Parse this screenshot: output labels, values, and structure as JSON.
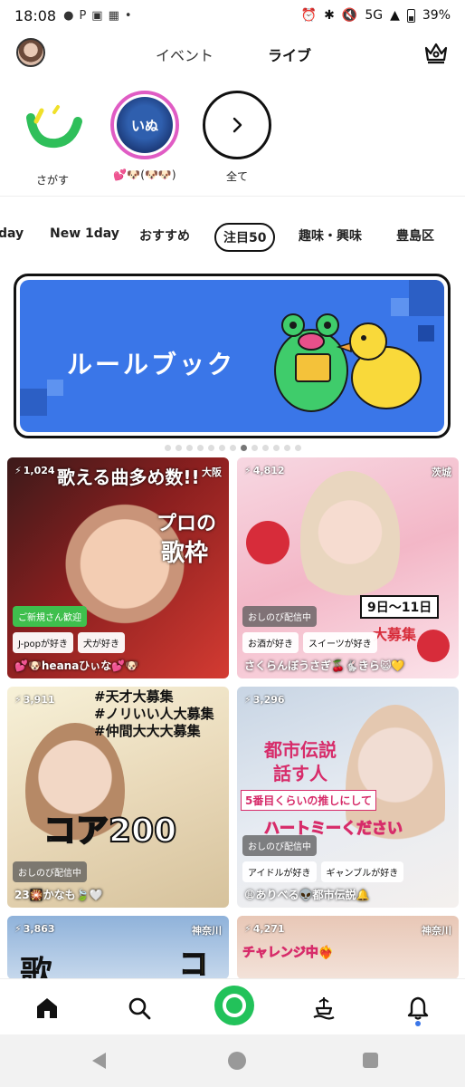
{
  "status_bar": {
    "time": "18:08",
    "network": "5G",
    "battery": "39%"
  },
  "header": {
    "tabs": [
      "イベント",
      "ライブ"
    ],
    "active_tab": "ライブ"
  },
  "stories": [
    {
      "label": "さがす"
    },
    {
      "label": "💕🐶(🐶🐶)",
      "circle_text": "いぬ"
    },
    {
      "label": "全て"
    }
  ],
  "categories": [
    "day",
    "New 1day",
    "おすすめ",
    "注目50",
    "趣味・興味",
    "豊島区"
  ],
  "active_category": "注目50",
  "banner": {
    "title": "ルールブック",
    "pages": 13,
    "current_page": 8
  },
  "cards": [
    {
      "viewers": "1,024",
      "region": "大阪",
      "overlay": [
        "歌える曲多め数!!",
        "プロの",
        "歌枠"
      ],
      "badge": "ご新規さん歓迎",
      "tags": [
        "J-popが好き",
        "犬が好き"
      ],
      "name": "💕🐶heanaひぃな💕🐶"
    },
    {
      "viewers": "4,812",
      "region": "茨城",
      "overlay": [
        "9日〜11日",
        "大募集"
      ],
      "badge": "おしのび配信中",
      "tags": [
        "お酒が好き",
        "スイーツが好き"
      ],
      "name": "さくらんぼうさぎ🍒🐇きら😺💛"
    },
    {
      "viewers": "3,911",
      "region": "",
      "overlay": [
        "#天才大募集",
        "#ノリいい人大募集",
        "#仲間大大大募集",
        "コア200"
      ],
      "badge": "おしのび配信中",
      "tags": [],
      "name": "23🎇かなも🍃🤍"
    },
    {
      "viewers": "3,296",
      "region": "",
      "overlay": [
        "都市伝説",
        "話す人",
        "5番目くらいの推しにして",
        "ハートミーください"
      ],
      "badge": "おしのび配信中",
      "tags": [
        "アイドルが好き",
        "ギャンブルが好き"
      ],
      "name": "😩ありべる👽都市伝説🔔"
    },
    {
      "viewers": "3,863",
      "region": "神奈川",
      "overlay": [
        "歌",
        "コ"
      ],
      "badge": "",
      "tags": [],
      "name": ""
    },
    {
      "viewers": "4,271",
      "region": "神奈川",
      "overlay": [
        "チャレンジ中❤️‍🔥"
      ],
      "badge": "",
      "tags": [],
      "name": ""
    }
  ],
  "colors": {
    "accent_green": "#22c25a",
    "banner_blue": "#3a76e8",
    "story_ring": "#e05cc4"
  }
}
